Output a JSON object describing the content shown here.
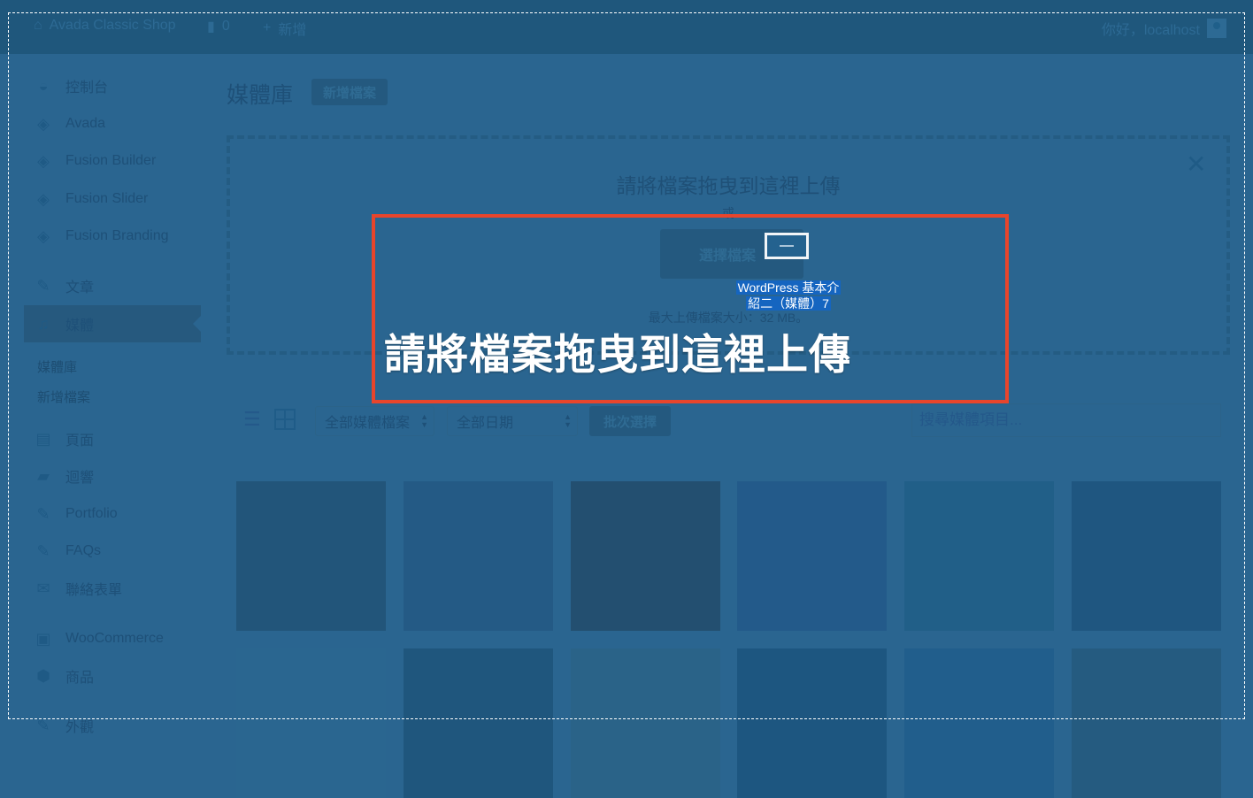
{
  "adminbar": {
    "site_name": "Avada Classic Shop",
    "comment_count": "0",
    "new_label": "新增",
    "greeting": "你好，localhost"
  },
  "sidebar": {
    "items": [
      {
        "label": "控制台",
        "icon": "dashboard-icon"
      },
      {
        "label": "Avada",
        "icon": "avada-icon"
      },
      {
        "label": "Fusion Builder",
        "icon": "avada-icon"
      },
      {
        "label": "Fusion Slider",
        "icon": "avada-icon"
      },
      {
        "label": "Fusion Branding",
        "icon": "avada-icon"
      },
      {
        "label": "文章",
        "icon": "pin-icon"
      },
      {
        "label": "媒體",
        "icon": "media-icon",
        "active": true
      },
      {
        "label": "頁面",
        "icon": "pages-icon"
      },
      {
        "label": "迴響",
        "icon": "comment-icon"
      },
      {
        "label": "Portfolio",
        "icon": "pin-icon"
      },
      {
        "label": "FAQs",
        "icon": "pin-icon"
      },
      {
        "label": "聯絡表單",
        "icon": "mail-icon"
      },
      {
        "label": "WooCommerce",
        "icon": "woo-icon"
      },
      {
        "label": "商品",
        "icon": "box-icon"
      },
      {
        "label": "外觀",
        "icon": "brush-icon"
      }
    ],
    "submenu": [
      "媒體庫",
      "新增檔案"
    ]
  },
  "main": {
    "title": "媒體庫",
    "add_new_label": "新增檔案",
    "uploader": {
      "title": "請將檔案拖曳到這裡上傳",
      "or": "或",
      "select_button": "選擇檔案",
      "max_size": "最大上傳檔案大小：32 MB。",
      "close_symbol": "✕"
    },
    "toolbar": {
      "filter_type": "全部媒體檔案",
      "filter_date": "全部日期",
      "bulk_select": "批次選擇",
      "search_placeholder": "搜尋媒體項目..."
    },
    "thumbnails_row1": [
      "#22557a",
      "#245a85",
      "#234f70",
      "#235a8a",
      "#215f88",
      "#1f5680"
    ],
    "thumbnails_row2": [
      "#2a6690",
      "#1f567d",
      "#2a6388",
      "#1d5680",
      "#215e8c",
      "#255b80"
    ]
  },
  "drag": {
    "label_line1": "WordPress 基本介",
    "label_line2": "紹二（媒體）7"
  },
  "overlay": {
    "caption": "請將檔案拖曳到這裡上傳",
    "highlight_color": "#e8452c"
  }
}
